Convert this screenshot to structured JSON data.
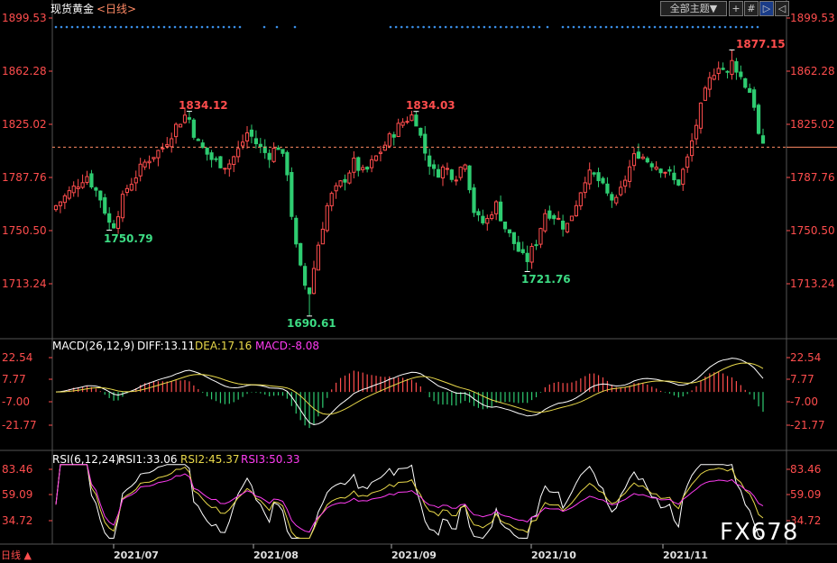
{
  "header": {
    "title": "现货黄金",
    "period_label": "<日线>",
    "dropdown_label": "全部主题▼",
    "tool_icons": [
      "plus-icon",
      "grid-icon",
      "next-icon",
      "prev-icon"
    ]
  },
  "colors": {
    "up": "#ff4d4d",
    "down": "#2ecc71",
    "bg": "#000000",
    "accent": "#ff8a65"
  },
  "chart_data": [
    {
      "type": "candlestick",
      "title": "现货黄金<日线>",
      "y_ticks": [
        "1899.53",
        "1862.28",
        "1825.02",
        "1787.76",
        "1750.50",
        "1713.24"
      ],
      "ylim": [
        1680,
        1905
      ],
      "x_ticks": [
        "2021/07",
        "2021/08",
        "2021/09",
        "2021/10",
        "2021/11"
      ],
      "annotations": [
        {
          "label": "1834.12",
          "type": "high"
        },
        {
          "label": "1750.79",
          "type": "low"
        },
        {
          "label": "1690.61",
          "type": "low"
        },
        {
          "label": "1834.03",
          "type": "high"
        },
        {
          "label": "1721.76",
          "type": "low"
        },
        {
          "label": "1877.15",
          "type": "high"
        }
      ],
      "last_price": 1809
    },
    {
      "type": "line",
      "title": "MACD(26,12,9)",
      "legend": {
        "diff": "DIFF:13.11",
        "dea": "DEA:17.16",
        "macd": "MACD:-8.08"
      },
      "y_ticks": [
        "22.54",
        "7.77",
        "-7.00",
        "-21.77"
      ],
      "ylim": [
        -36,
        24
      ]
    },
    {
      "type": "line",
      "title": "RSI(6,12,24)",
      "legend": {
        "rsi1": "RSI1:33.06",
        "rsi2": "RSI2:45.37",
        "rsi3": "RSI3:50.33"
      },
      "y_ticks": [
        "83.46",
        "59.09",
        "34.72"
      ],
      "ylim": [
        15,
        90
      ]
    }
  ],
  "footer": {
    "label": "日线 ▲"
  },
  "watermark": "FX678"
}
